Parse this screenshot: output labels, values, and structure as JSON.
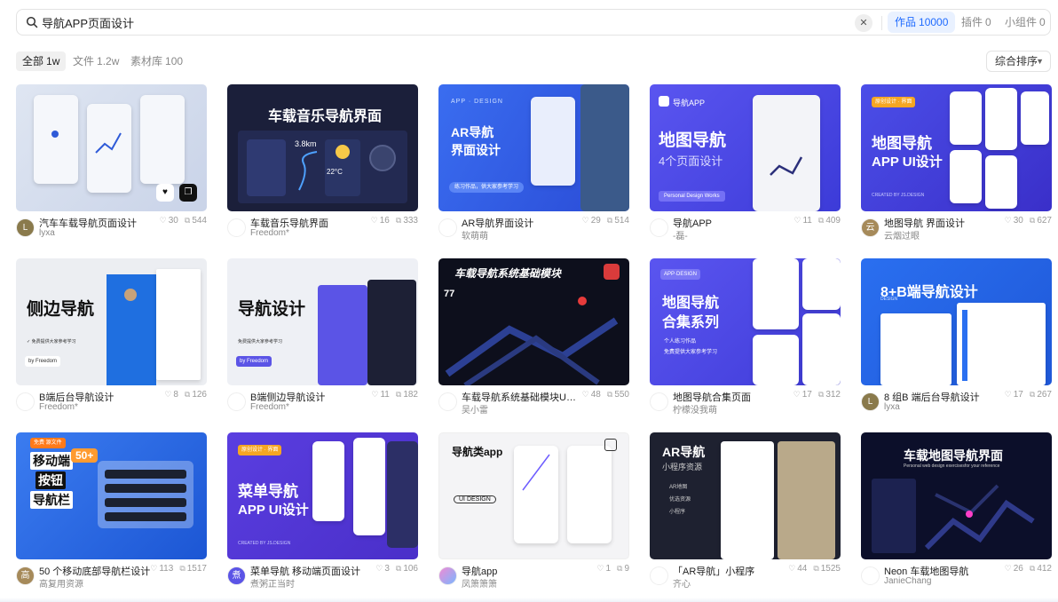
{
  "search": {
    "query": "导航APP页面设计",
    "clear_icon": "close-icon",
    "tabs": [
      {
        "label": "作品",
        "count": "10000"
      },
      {
        "label": "插件",
        "count": "0"
      },
      {
        "label": "小组件",
        "count": "0"
      }
    ]
  },
  "filters": [
    {
      "label": "全部",
      "count": "1w"
    },
    {
      "label": "文件",
      "count": "1.2w"
    },
    {
      "label": "素材库",
      "count": "100"
    }
  ],
  "sort": {
    "label": "综合排序"
  },
  "colors": {
    "accent": "#1f6bff",
    "accent_bg": "#e9f1ff"
  },
  "cards": [
    {
      "title": "汽车车载导航页面设计",
      "author": "lyxa",
      "likes": "30",
      "copies": "544",
      "avatar": "L",
      "thumb": {
        "title": "",
        "subtitle": ""
      }
    },
    {
      "title": "车载音乐导航界面",
      "author": "Freedom*",
      "likes": "16",
      "copies": "333",
      "avatar": "",
      "thumb": {
        "title": "车载音乐导航界面",
        "subtitle": "3.8km",
        "temp": "22°C"
      }
    },
    {
      "title": "AR导航界面设计",
      "author": "软萌萌",
      "likes": "29",
      "copies": "514",
      "avatar": "",
      "thumb": {
        "title": "AR导航",
        "subtitle": "界面设计",
        "tag": "APP · DESIGN",
        "pill": "练习作品，供大家参考学习"
      }
    },
    {
      "title": "导航APP",
      "author": "-磊-",
      "likes": "11",
      "copies": "409",
      "avatar": "",
      "thumb": {
        "title": "地图导航",
        "subtitle": "4个页面设计",
        "tag": "导航APP",
        "pill": "Personal Design Works"
      }
    },
    {
      "title": "地图导航 界面设计",
      "author": "云烟过眼",
      "likes": "30",
      "copies": "627",
      "avatar": "云",
      "thumb": {
        "title": "地图导航",
        "subtitle": "APP UI设计",
        "tag": "原创设计 · 界面",
        "credit": "CREATED BY JS.DESIGN"
      }
    },
    {
      "title": "B端后台导航设计",
      "author": "Freedom*",
      "likes": "8",
      "copies": "126",
      "avatar": "",
      "thumb": {
        "title": "侧边导航",
        "subtitle": "✓ 免费提供大家参考学习",
        "tag": "by Freedom"
      }
    },
    {
      "title": "B端侧边导航设计",
      "author": "Freedom*",
      "likes": "11",
      "copies": "182",
      "avatar": "",
      "thumb": {
        "title": "导航设计",
        "subtitle": "免费提供大家参考学习",
        "tag": "by Freedom"
      }
    },
    {
      "title": "车载导航系统基础模块UI设...",
      "author": "吴小雷",
      "likes": "48",
      "copies": "550",
      "avatar": "",
      "thumb": {
        "title": "车载导航系统基础模块",
        "subtitle": "77"
      }
    },
    {
      "title": "地图导航合集页面",
      "author": "柠檬没我萌",
      "likes": "17",
      "copies": "312",
      "avatar": "",
      "thumb": {
        "title": "地图导航",
        "subtitle": "合集系列",
        "tag": "APP·DESIGN",
        "line1": "个人练习作品",
        "line2": "免费提供大家参考学习"
      }
    },
    {
      "title": "8 组B 端后台导航设计",
      "author": "lyxa",
      "likes": "17",
      "copies": "267",
      "avatar": "L",
      "thumb": {
        "title": "8+B端导航设计",
        "subtitle": "DESIGN"
      }
    },
    {
      "title": "50 个移动底部导航栏设计",
      "author": "高复用资源",
      "likes": "113",
      "copies": "1517",
      "avatar": "高",
      "thumb": {
        "title": "移动端",
        "subtitle": "导航栏",
        "tag": "免费 源文件",
        "badge": "50+",
        "mid": "按钮"
      }
    },
    {
      "title": "菜单导航 移动端页面设计",
      "author": "煮粥正当时",
      "likes": "3",
      "copies": "106",
      "avatar": "煮",
      "thumb": {
        "title": "菜单导航",
        "subtitle": "APP UI设计",
        "tag": "原创设计 · 界面",
        "credit": "CREATED BY JS.DESIGN"
      }
    },
    {
      "title": "导航app",
      "author": "凤箫箫箫",
      "likes": "1",
      "copies": "9",
      "avatar": "",
      "thumb": {
        "title": "导航类app",
        "subtitle": "UI DESIGN"
      }
    },
    {
      "title": "「AR导航」小程序",
      "author": "齐心",
      "likes": "44",
      "copies": "1525",
      "avatar": "",
      "thumb": {
        "title": "AR导航",
        "subtitle": "小程序资源",
        "line1": "AR地图",
        "line2": "优选资源",
        "line3": "小程序"
      }
    },
    {
      "title": "Neon 车载地图导航",
      "author": "JanieChang",
      "likes": "26",
      "copies": "412",
      "avatar": "",
      "thumb": {
        "title": "车载地图导航界面",
        "subtitle": "Personal web design exercisesfor your reference"
      }
    }
  ]
}
